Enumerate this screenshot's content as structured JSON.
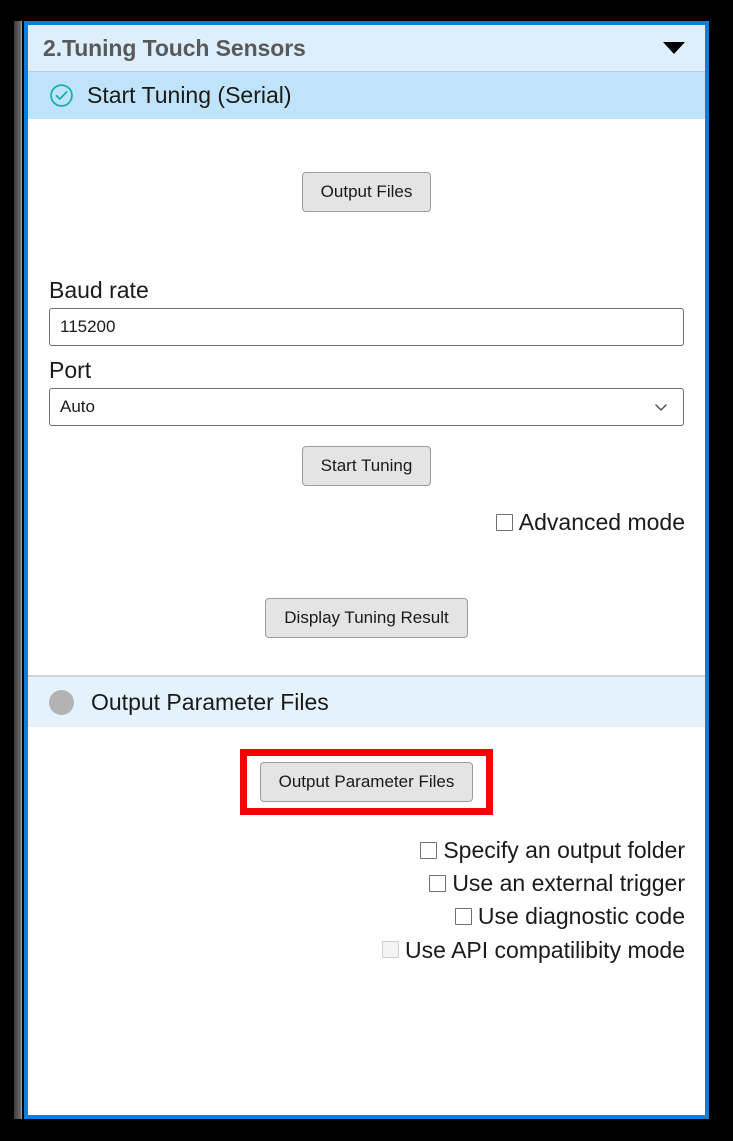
{
  "group": {
    "title": "2.Tuning Touch Sensors",
    "collapse_icon": "chevron-down-icon"
  },
  "colors": {
    "panel_border": "#0f7ddb",
    "title_bar_bg": "#ddeffc",
    "active_step_bg": "#bfe3fa",
    "idle_step_bg": "#e3f2fd",
    "check_circle": "#18b0a8",
    "idle_dot": "#b3b3b3",
    "highlight": "#fb0000",
    "button_face": "#e4e4e4"
  },
  "sections": {
    "start_tuning": {
      "header_label": "Start Tuning (Serial)",
      "status_icon": "check-circle-icon",
      "output_files_button": "Output Files",
      "baud_rate": {
        "label": "Baud rate",
        "value": "115200",
        "placeholder": "Baud rate"
      },
      "port": {
        "label": "Port",
        "value": "Auto",
        "dropdown_icon": "chevron-down-icon"
      },
      "start_tuning_button": "Start Tuning",
      "advanced_mode": {
        "label": "Advanced mode",
        "checked": false
      },
      "display_result_button": "Display Tuning Result"
    },
    "output_parameter_files": {
      "header_label": "Output Parameter Files",
      "status_icon": "circle-icon",
      "main_button": "Output Parameter Files",
      "options": [
        {
          "label": "Specify an output folder",
          "checked": false,
          "disabled": false
        },
        {
          "label": "Use an external trigger",
          "checked": false,
          "disabled": false
        },
        {
          "label": "Use diagnostic code",
          "checked": false,
          "disabled": false
        },
        {
          "label": "Use API compatilibity mode",
          "checked": false,
          "disabled": true
        }
      ]
    }
  }
}
